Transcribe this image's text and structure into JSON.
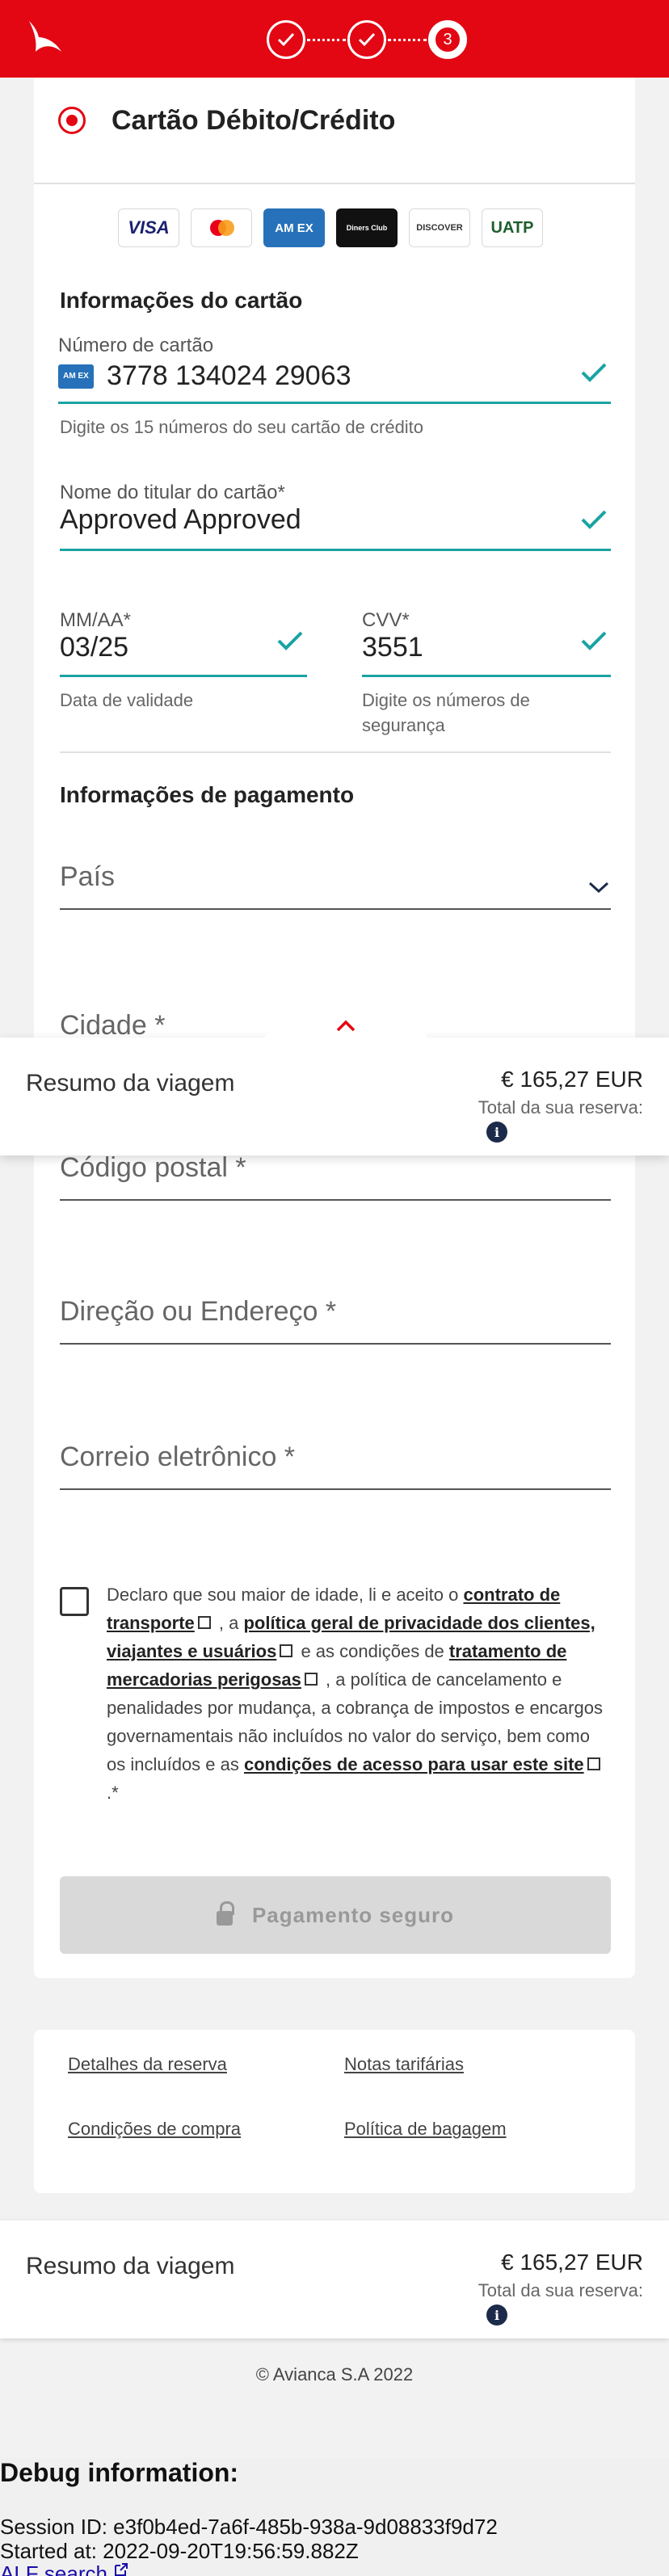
{
  "header": {
    "steps": [
      {
        "state": "done"
      },
      {
        "state": "done"
      },
      {
        "state": "current",
        "number": "3"
      }
    ]
  },
  "payment_method": {
    "label": "Cartão Débito/Crédito"
  },
  "card_brands": [
    "VISA",
    "mastercard",
    "AM EX",
    "Diners Club",
    "DISCOVER",
    "UATP"
  ],
  "card_info": {
    "title": "Informações do cartão",
    "number_label": "Número de cartão",
    "number_value": "3778 134024 29063",
    "number_hint": "Digite os 15 números do seu cartão de crédito",
    "holder_label": "Nome do titular do cartão*",
    "holder_value": "Approved Approved",
    "expiry_label": "MM/AA*",
    "expiry_value": "03/25",
    "expiry_hint": "Data de validade",
    "cvv_label": "CVV*",
    "cvv_value": "3551",
    "cvv_hint_1": "Digite os números de",
    "cvv_hint_2": "segurança"
  },
  "payment_info": {
    "title": "Informações de pagamento",
    "country_placeholder": "País",
    "city_placeholder": "Cidade *",
    "postal_placeholder": "Código postal *",
    "address_placeholder": "Direção ou Endereço *",
    "email_placeholder": "Correio eletrônico *"
  },
  "consent": {
    "t1": "Declaro que sou maior de idade, li e aceito o ",
    "l1": "contrato de transporte",
    "t2": " , a ",
    "l2": "política geral de privacidade dos clientes, viajantes e usuários",
    "t3": " e as condições de ",
    "l3": "tratamento de mercadorias perigosas",
    "t4": " , a política de cancelamento e penalidades por mudança, a cobrança de impostos e encargos governamentais não incluídos no valor do serviço, bem como os incluídos e as ",
    "l4": "condições de acesso para usar este site",
    "t5": " .*"
  },
  "pay_button": {
    "label": "Pagamento seguro"
  },
  "footer_links": {
    "booking_details": "Detalhes da reserva",
    "fare_notes": "Notas tarifárias",
    "purchase_conditions": "Condições de compra",
    "baggage_policy": "Política de bagagem"
  },
  "summary": {
    "title": "Resumo da viagem",
    "price": "€ 165,27 EUR",
    "total_label": "Total da sua reserva:",
    "info_icon": "i"
  },
  "copyright": "© Avianca S.A 2022",
  "debug": {
    "title": "Debug information:",
    "session": "Session ID: e3f0b4ed-7a6f-485b-938a-9d08833f9d72",
    "started": "Started at: 2022-09-20T19:56:59.882Z",
    "link": "ALF search"
  },
  "colors": {
    "brand_red": "#e30613",
    "accent_teal": "#1aa3a3",
    "navy": "#1c2b4a"
  }
}
